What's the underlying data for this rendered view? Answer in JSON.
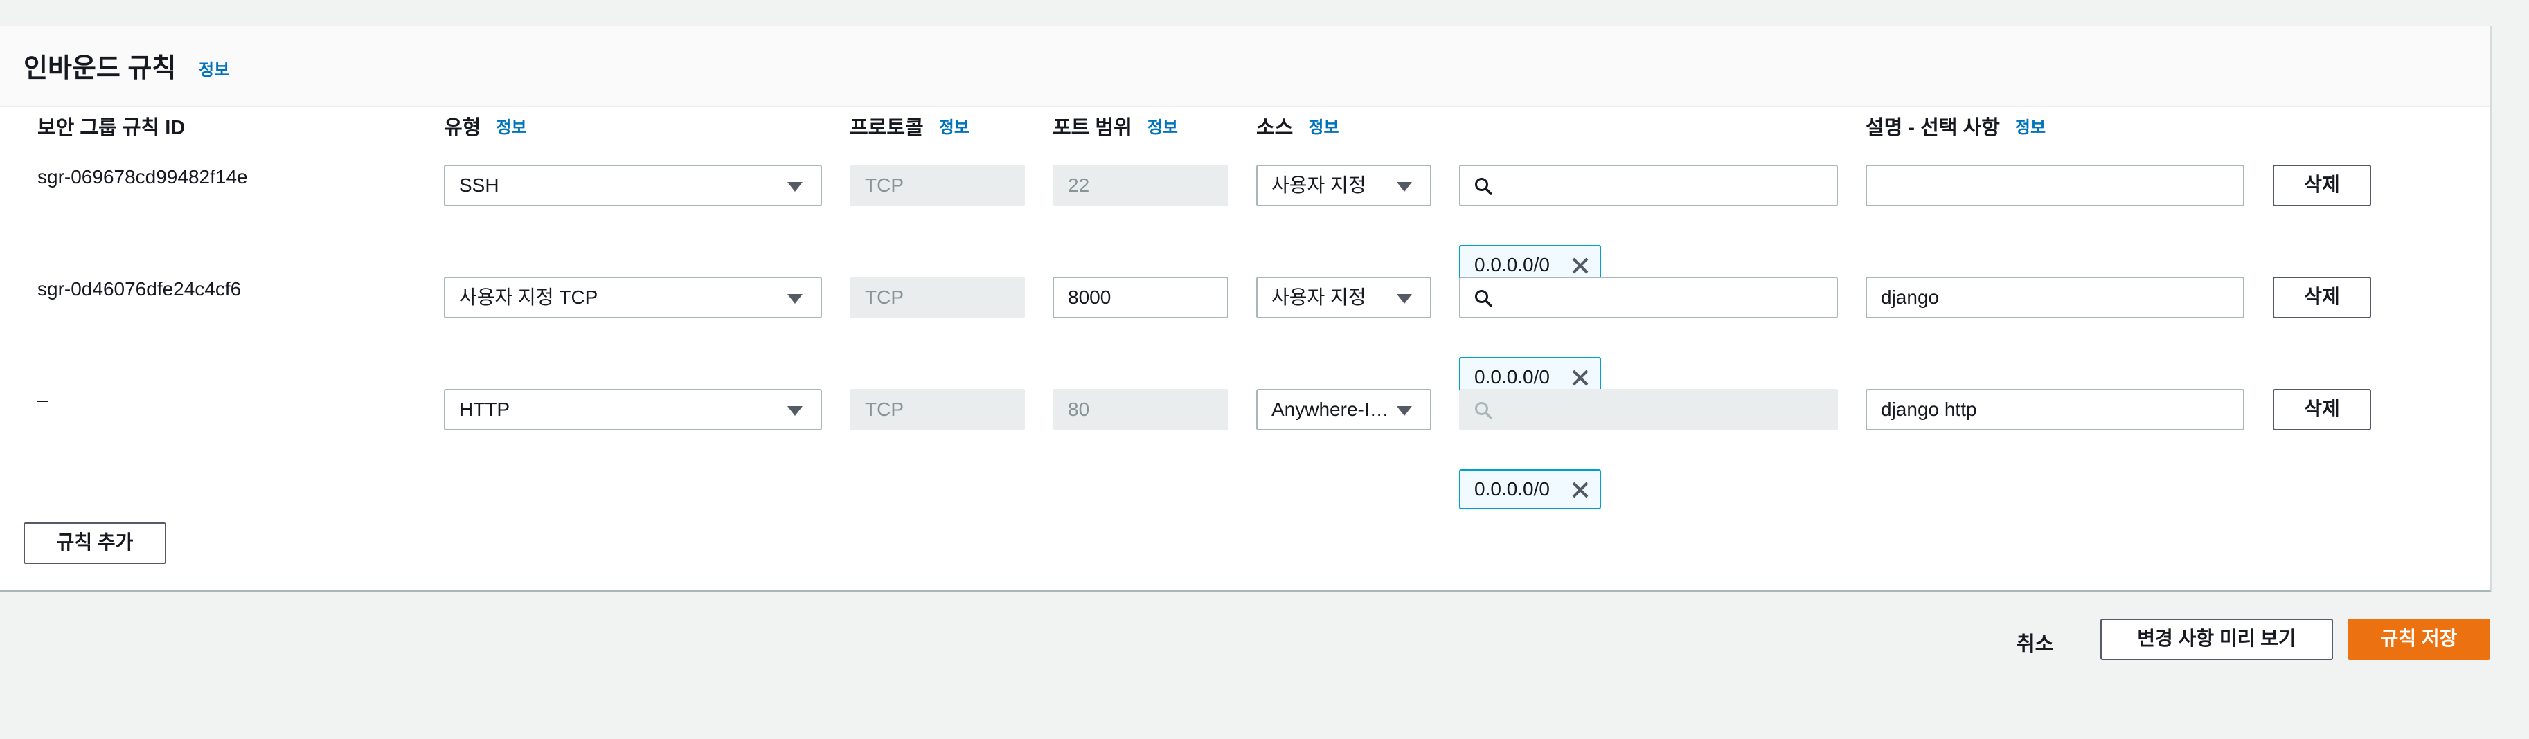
{
  "panel": {
    "title": "인바운드 규칙",
    "info": "정보"
  },
  "columns": {
    "rule_id": "보안 그룹 규칙 ID",
    "type": "유형",
    "type_info": "정보",
    "protocol": "프로토콜",
    "protocol_info": "정보",
    "port": "포트 범위",
    "port_info": "정보",
    "source": "소스",
    "source_info": "정보",
    "description": "설명 - 선택 사항",
    "description_info": "정보"
  },
  "rules": [
    {
      "id": "sgr-069678cd99482f14e",
      "type": "SSH",
      "protocol": "TCP",
      "port": "22",
      "source": "사용자 지정",
      "search": "",
      "cidr": "0.0.0.0/0",
      "description": "",
      "delete": "삭제"
    },
    {
      "id": "sgr-0d46076dfe24c4cf6",
      "type": "사용자 지정 TCP",
      "protocol": "TCP",
      "port": "8000",
      "source": "사용자 지정",
      "search": "",
      "cidr": "0.0.0.0/0",
      "description": "django",
      "delete": "삭제"
    },
    {
      "id": "–",
      "type": "HTTP",
      "protocol": "TCP",
      "port": "80",
      "source": "Anywhere-I…",
      "search": "",
      "cidr": "0.0.0.0/0",
      "description": "django http",
      "delete": "삭제"
    }
  ],
  "add_rule": "규칙 추가",
  "footer": {
    "cancel": "취소",
    "preview": "변경 사항 미리 보기",
    "save": "규칙 저장"
  },
  "colors": {
    "accent": "#ec7211",
    "link": "#0073bb",
    "token_border": "#00a1c9"
  }
}
